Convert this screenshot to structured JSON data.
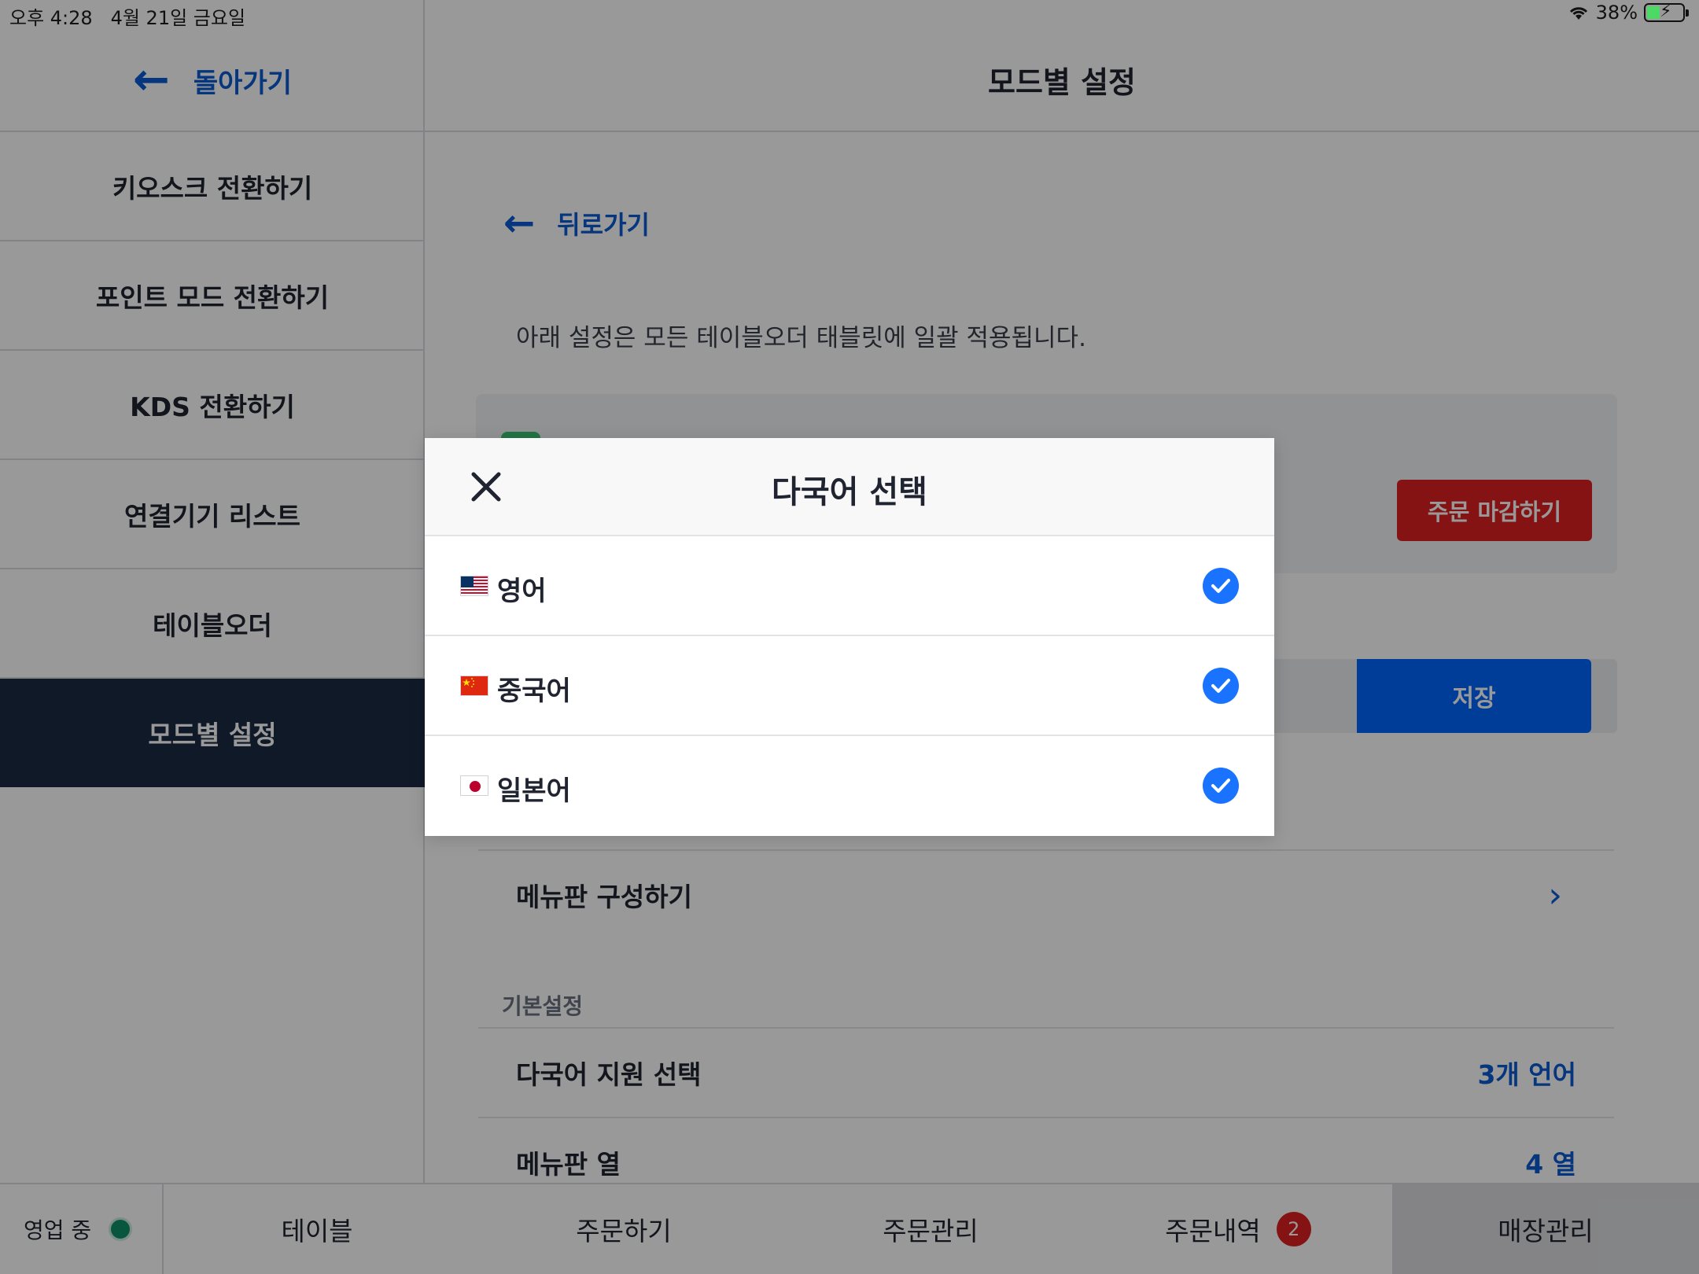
{
  "status_bar": {
    "time": "오후 4:28",
    "date": "4월 21일 금요일",
    "battery": "38%"
  },
  "sidebar": {
    "back_label": "돌아가기",
    "items": [
      {
        "label": "키오스크 전환하기"
      },
      {
        "label": "포인트 모드 전환하기"
      },
      {
        "label": "KDS 전환하기"
      },
      {
        "label": "연결기기 리스트"
      },
      {
        "label": "테이블오더"
      },
      {
        "label": "모드별 설정",
        "active": true
      }
    ]
  },
  "header": {
    "title": "모드별 설정"
  },
  "content": {
    "back_label": "뒤로가기",
    "notice": "아래 설정은 모든 테이블오더 태블릿에 일괄 적용됩니다.",
    "card_button": "주문 마감하기",
    "save_label": "저장",
    "menu_config": "메뉴판 구성하기",
    "basic_section": "기본설정",
    "rows": [
      {
        "label": "다국어 지원 선택",
        "value": "3개 언어"
      },
      {
        "label": "메뉴판 열",
        "value": "4 열"
      }
    ]
  },
  "tabbar": {
    "status_label": "영업 중",
    "tabs": [
      {
        "label": "테이블"
      },
      {
        "label": "주문하기"
      },
      {
        "label": "주문관리"
      },
      {
        "label": "주문내역",
        "badge": "2"
      },
      {
        "label": "매장관리",
        "active": true
      }
    ]
  },
  "modal": {
    "title": "다국어 선택",
    "options": [
      {
        "label": "영어",
        "flag": "us-flag-icon",
        "checked": true
      },
      {
        "label": "중국어",
        "flag": "cn-flag-icon",
        "checked": true
      },
      {
        "label": "일본어",
        "flag": "jp-flag-icon",
        "checked": true
      }
    ]
  },
  "colors": {
    "accent": "#0a5bd1",
    "danger": "#e02020",
    "sidebar_active": "#1c2a44",
    "check": "#1a73ff"
  }
}
